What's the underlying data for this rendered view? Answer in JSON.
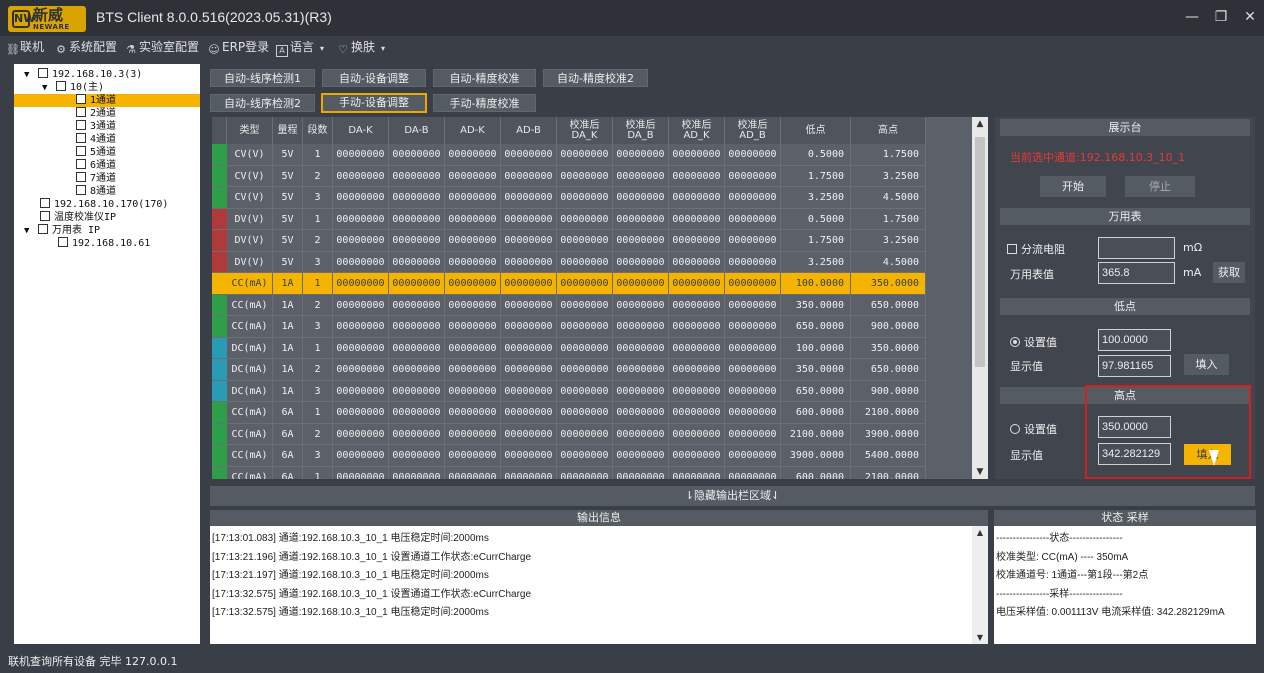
{
  "window": {
    "logo_cn": "新威",
    "logo_en": "NEWARE",
    "title": "BTS Client 8.0.0.516(2023.05.31)(R3)"
  },
  "menu": [
    {
      "label": "联机",
      "icon": "link-icon"
    },
    {
      "label": "系统配置",
      "icon": "gear-icon"
    },
    {
      "label": "实验室配置",
      "icon": "flask-icon"
    },
    {
      "label": "ERP登录",
      "icon": "user-icon"
    },
    {
      "label": "语言",
      "icon": "language-icon"
    },
    {
      "label": "换肤",
      "icon": "shirt-icon"
    }
  ],
  "tree": {
    "nodes": [
      {
        "label": "192.168.10.3(3)",
        "expander": "▼"
      },
      {
        "label": "10(主)",
        "expander": "▼"
      },
      {
        "label": "1通道",
        "expander": "",
        "selected": true
      },
      {
        "label": "2通道",
        "expander": ""
      },
      {
        "label": "3通道",
        "expander": ""
      },
      {
        "label": "4通道",
        "expander": ""
      },
      {
        "label": "5通道",
        "expander": ""
      },
      {
        "label": "6通道",
        "expander": ""
      },
      {
        "label": "7通道",
        "expander": ""
      },
      {
        "label": "8通道",
        "expander": ""
      },
      {
        "label": "192.168.10.170(170)",
        "expander": ""
      },
      {
        "label": "温度校准仪IP",
        "expander": ""
      },
      {
        "label": "万用表 IP",
        "expander": "▼"
      },
      {
        "label": "192.168.10.61",
        "expander": ""
      }
    ]
  },
  "tabs": {
    "row1": [
      "自动-线序检测1",
      "自动-设备调整",
      "自动-精度校准",
      "自动-精度校准2"
    ],
    "row2": [
      "自动-线序检测2",
      "手动-设备调整",
      "手动-精度校准"
    ],
    "active": "手动-设备调整"
  },
  "table": {
    "headers": [
      "类型",
      "量程",
      "段数",
      "DA-K",
      "DA-B",
      "AD-K",
      "AD-B",
      "校准后\nDA_K",
      "校准后\nDA_B",
      "校准后\nAD_K",
      "校准后\nAD_B",
      "低点",
      "高点"
    ],
    "rows": [
      {
        "marker": "#2e9e48",
        "cells": [
          "CV(V)",
          "5V",
          "1",
          "00000000",
          "00000000",
          "00000000",
          "00000000",
          "00000000",
          "00000000",
          "00000000",
          "00000000",
          "0.5000",
          "1.7500"
        ]
      },
      {
        "marker": "#2e9e48",
        "cells": [
          "CV(V)",
          "5V",
          "2",
          "00000000",
          "00000000",
          "00000000",
          "00000000",
          "00000000",
          "00000000",
          "00000000",
          "00000000",
          "1.7500",
          "3.2500"
        ]
      },
      {
        "marker": "#2e9e48",
        "cells": [
          "CV(V)",
          "5V",
          "3",
          "00000000",
          "00000000",
          "00000000",
          "00000000",
          "00000000",
          "00000000",
          "00000000",
          "00000000",
          "3.2500",
          "4.5000"
        ]
      },
      {
        "marker": "#b03a3a",
        "cells": [
          "DV(V)",
          "5V",
          "1",
          "00000000",
          "00000000",
          "00000000",
          "00000000",
          "00000000",
          "00000000",
          "00000000",
          "00000000",
          "0.5000",
          "1.7500"
        ]
      },
      {
        "marker": "#b03a3a",
        "cells": [
          "DV(V)",
          "5V",
          "2",
          "00000000",
          "00000000",
          "00000000",
          "00000000",
          "00000000",
          "00000000",
          "00000000",
          "00000000",
          "1.7500",
          "3.2500"
        ]
      },
      {
        "marker": "#b03a3a",
        "cells": [
          "DV(V)",
          "5V",
          "3",
          "00000000",
          "00000000",
          "00000000",
          "00000000",
          "00000000",
          "00000000",
          "00000000",
          "00000000",
          "3.2500",
          "4.5000"
        ]
      },
      {
        "marker": "#f5b400",
        "selected": true,
        "cells": [
          "CC(mA)",
          "1A",
          "1",
          "00000000",
          "00000000",
          "00000000",
          "00000000",
          "00000000",
          "00000000",
          "00000000",
          "00000000",
          "100.0000",
          "350.0000"
        ]
      },
      {
        "marker": "#2e9e48",
        "cells": [
          "CC(mA)",
          "1A",
          "2",
          "00000000",
          "00000000",
          "00000000",
          "00000000",
          "00000000",
          "00000000",
          "00000000",
          "00000000",
          "350.0000",
          "650.0000"
        ]
      },
      {
        "marker": "#2e9e48",
        "cells": [
          "CC(mA)",
          "1A",
          "3",
          "00000000",
          "00000000",
          "00000000",
          "00000000",
          "00000000",
          "00000000",
          "00000000",
          "00000000",
          "650.0000",
          "900.0000"
        ]
      },
      {
        "marker": "#2a9bb5",
        "cells": [
          "DC(mA)",
          "1A",
          "1",
          "00000000",
          "00000000",
          "00000000",
          "00000000",
          "00000000",
          "00000000",
          "00000000",
          "00000000",
          "100.0000",
          "350.0000"
        ]
      },
      {
        "marker": "#2a9bb5",
        "cells": [
          "DC(mA)",
          "1A",
          "2",
          "00000000",
          "00000000",
          "00000000",
          "00000000",
          "00000000",
          "00000000",
          "00000000",
          "00000000",
          "350.0000",
          "650.0000"
        ]
      },
      {
        "marker": "#2a9bb5",
        "cells": [
          "DC(mA)",
          "1A",
          "3",
          "00000000",
          "00000000",
          "00000000",
          "00000000",
          "00000000",
          "00000000",
          "00000000",
          "00000000",
          "650.0000",
          "900.0000"
        ]
      },
      {
        "marker": "#2e9e48",
        "cells": [
          "CC(mA)",
          "6A",
          "1",
          "00000000",
          "00000000",
          "00000000",
          "00000000",
          "00000000",
          "00000000",
          "00000000",
          "00000000",
          "600.0000",
          "2100.0000"
        ]
      },
      {
        "marker": "#2e9e48",
        "cells": [
          "CC(mA)",
          "6A",
          "2",
          "00000000",
          "00000000",
          "00000000",
          "00000000",
          "00000000",
          "00000000",
          "00000000",
          "00000000",
          "2100.0000",
          "3900.0000"
        ]
      },
      {
        "marker": "#2e9e48",
        "cells": [
          "CC(mA)",
          "6A",
          "3",
          "00000000",
          "00000000",
          "00000000",
          "00000000",
          "00000000",
          "00000000",
          "00000000",
          "00000000",
          "3900.0000",
          "5400.0000"
        ]
      },
      {
        "marker": "#2e9e48",
        "cells": [
          "CC(mA)",
          "6A",
          "1",
          "00000000",
          "00000000",
          "00000000",
          "00000000",
          "00000000",
          "00000000",
          "00000000",
          "00000000",
          "600.0000",
          "2100.0000"
        ]
      }
    ]
  },
  "panel": {
    "display_title": "展示台",
    "channel_text": "当前选中通道:192.168.10.3_10_1",
    "channel_color": "#e53935",
    "start_label": "开始",
    "stop_label": "停止",
    "meter_title": "万用表",
    "shunt_label": "分流电阻",
    "shunt_value": "",
    "shunt_unit": "mΩ",
    "meter_label": "万用表值",
    "meter_value": "365.8",
    "meter_unit": "mA",
    "fetch_label": "获取",
    "low_title": "低点",
    "low_set_label": "设置值",
    "low_set_value": "100.0000",
    "low_disp_label": "显示值",
    "low_disp_value": "97.981165",
    "fill_label": "填入",
    "high_title": "高点",
    "high_set_label": "设置值",
    "high_set_value": "350.0000",
    "high_disp_label": "显示值",
    "high_disp_value": "342.282129",
    "high_fill_label": "填入",
    "accent_color": "#f5b400"
  },
  "toggle_bar": "⇂隐藏输出栏区域⇃",
  "output": {
    "title": "输出信息",
    "lines": [
      "[17:13:01.083] 通道:192.168.10.3_10_1 电压稳定时间:2000ms",
      "[17:13:21.196] 通道:192.168.10.3_10_1 设置通道工作状态:eCurrCharge",
      "[17:13:21.197] 通道:192.168.10.3_10_1 电压稳定时间:2000ms",
      "[17:13:32.575] 通道:192.168.10.3_10_1 设置通道工作状态:eCurrCharge",
      "[17:13:32.575] 通道:192.168.10.3_10_1 电压稳定时间:2000ms"
    ]
  },
  "status_panel": {
    "title": "状态 采样",
    "lines": [
      "----------------状态----------------",
      "校准类型: CC(mA) ---- 350mA",
      "校准通道号: 1通道---第1段---第2点",
      "----------------采样----------------",
      "电压采样值: 0.001113V  电流采样值: 342.282129mA"
    ]
  },
  "statusbar": "联机查询所有设备 完毕 127.0.0.1"
}
